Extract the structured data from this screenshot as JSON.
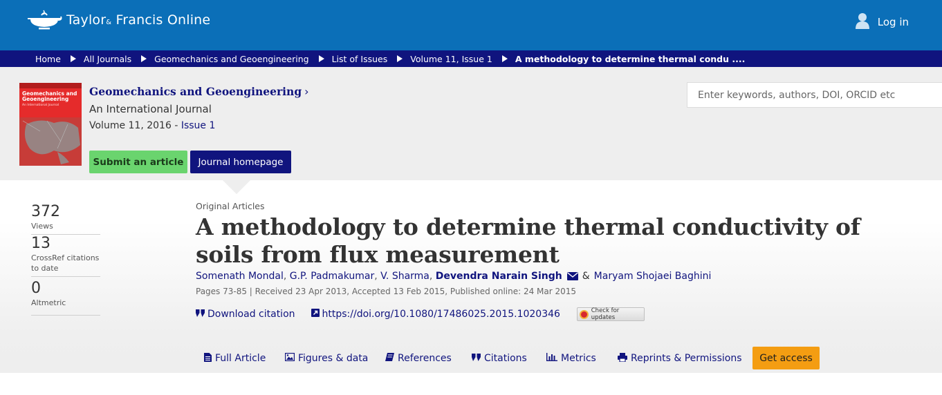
{
  "header": {
    "brand": {
      "name_part1": "Taylor",
      "name_amp": "&",
      "name_part2": "Francis Online",
      "icon": "teapot-lamp-logo"
    },
    "login_label": "Log in",
    "login_icon": "user-icon",
    "bar_color": "#0b6fb8"
  },
  "breadcrumb": {
    "items": [
      "Home",
      "All Journals",
      "Geomechanics and Geoengineering",
      "List of Issues",
      "Volume 11, Issue 1",
      "A methodology to determine thermal condu ...."
    ],
    "bar_color": "#10147e"
  },
  "journal": {
    "cover": {
      "title_line1": "Geomechanics and",
      "title_line2": "Geoengineering",
      "subtitle": "An International Journal"
    },
    "name": "Geomechanics and Geoengineering",
    "chevron": "›",
    "subtitle": "An International Journal",
    "volume_text": "Volume 11, 2016 - ",
    "issue_link": "Issue 1",
    "submit_label": "Submit an article",
    "homepage_label": "Journal homepage"
  },
  "search": {
    "placeholder": "Enter keywords, authors, DOI, ORCID etc"
  },
  "metrics": [
    {
      "value": "372",
      "label": "Views"
    },
    {
      "value": "13",
      "label": "CrossRef citations to date"
    },
    {
      "value": "0",
      "label": "Altmetric"
    }
  ],
  "article": {
    "section": "Original Articles",
    "title": "A methodology to determine thermal conductivity of soils from flux measurement",
    "authors": [
      "Somenath Mondal",
      "G.P. Padmakumar",
      "V. Sharma",
      "Devendra Narain Singh",
      "Maryam Shojaei Baghini"
    ],
    "author_amp": "&",
    "corresponding_icon": "envelope-icon",
    "pages_line": "Pages 73-85 | Received 23 Apr 2013, Accepted 13 Feb 2015, Published online: 24 Mar 2015",
    "download_citation": "Download citation",
    "doi": "https://doi.org/10.1080/17486025.2015.1020346",
    "check_updates": "Check for updates"
  },
  "tabs": [
    {
      "label": "Full Article",
      "icon": "document-icon"
    },
    {
      "label": "Figures & data",
      "icon": "image-icon"
    },
    {
      "label": "References",
      "icon": "book-icon"
    },
    {
      "label": "Citations",
      "icon": "quote-icon"
    },
    {
      "label": "Metrics",
      "icon": "bar-chart-icon"
    },
    {
      "label": "Reprints & Permissions",
      "icon": "printer-icon"
    }
  ],
  "get_access_label": "Get access",
  "colors": {
    "navy": "#10147e",
    "green": "#6ad46e",
    "orange": "#f49d12"
  }
}
